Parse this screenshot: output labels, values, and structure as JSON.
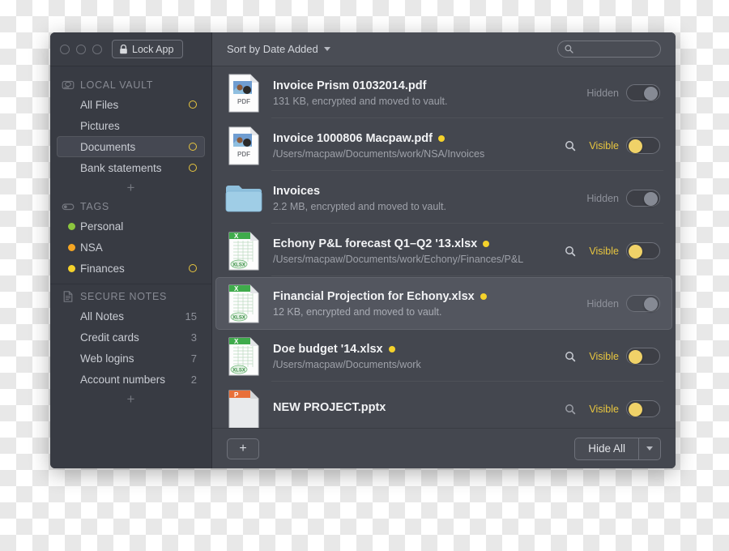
{
  "window": {
    "traffic_lights": [
      "close",
      "minimize",
      "zoom"
    ],
    "lock_button_label": "Lock App"
  },
  "sidebar": {
    "sections": [
      {
        "id": "local-vault",
        "title": "LOCAL VAULT",
        "icon": "hard-drive-icon",
        "items": [
          {
            "label": "All Files",
            "selected": false,
            "ring": true
          },
          {
            "label": "Pictures",
            "selected": false,
            "ring": false
          },
          {
            "label": "Documents",
            "selected": true,
            "ring": true
          },
          {
            "label": "Bank statements",
            "selected": false,
            "ring": true
          }
        ],
        "add_label": "+"
      },
      {
        "id": "tags",
        "title": "TAGS",
        "icon": "tag-toggle-icon",
        "items": [
          {
            "label": "Personal",
            "dot": "#8CC63E",
            "ring": false
          },
          {
            "label": "NSA",
            "dot": "#F5A623",
            "ring": false
          },
          {
            "label": "Finances",
            "dot": "#F5D22B",
            "ring": true
          }
        ]
      },
      {
        "id": "secure-notes",
        "title": "SECURE NOTES",
        "icon": "note-icon",
        "items": [
          {
            "label": "All Notes",
            "count": "15"
          },
          {
            "label": "Credit cards",
            "count": "3"
          },
          {
            "label": "Web logins",
            "count": "7"
          },
          {
            "label": "Account numbers",
            "count": "2"
          }
        ],
        "add_label": "+"
      }
    ]
  },
  "toolbar": {
    "sort_label": "Sort by Date Added",
    "sort_icon": "chevron-down-icon",
    "search_placeholder": "",
    "search_value": "",
    "search_icon": "search-icon"
  },
  "files": [
    {
      "title": "Invoice Prism 01032014.pdf",
      "subtitle": "131 KB, encrypted and moved to vault.",
      "icon": "pdf-file-icon",
      "tag_color": null,
      "state_label": "Hidden",
      "state": "hidden",
      "has_reveal": false,
      "selected": false
    },
    {
      "title": "Invoice 1000806 Macpaw.pdf",
      "subtitle": "/Users/macpaw/Documents/work/NSA/Invoices",
      "icon": "pdf-file-icon",
      "tag_color": "#F5D22B",
      "state_label": "Visible",
      "state": "visible",
      "has_reveal": true,
      "selected": false
    },
    {
      "title": "Invoices",
      "subtitle": "2.2 MB, encrypted and moved to vault.",
      "icon": "folder-icon",
      "tag_color": null,
      "state_label": "Hidden",
      "state": "hidden",
      "has_reveal": false,
      "selected": false
    },
    {
      "title": "Echony P&L forecast Q1–Q2 '13.xlsx",
      "subtitle": "/Users/macpaw/Documents/work/Echony/Finances/P&L",
      "icon": "xlsx-file-icon",
      "tag_color": "#F5D22B",
      "state_label": "Visible",
      "state": "visible",
      "has_reveal": true,
      "selected": false
    },
    {
      "title": "Financial Projection for Echony.xlsx",
      "subtitle": "12 KB, encrypted and moved to vault.",
      "icon": "xlsx-file-icon",
      "tag_color": "#F5D22B",
      "state_label": "Hidden",
      "state": "hidden",
      "has_reveal": false,
      "selected": true
    },
    {
      "title": "Doe budget '14.xlsx",
      "subtitle": "/Users/macpaw/Documents/work",
      "icon": "xlsx-file-icon",
      "tag_color": "#F5D22B",
      "state_label": "Visible",
      "state": "visible",
      "has_reveal": true,
      "selected": false
    },
    {
      "title": "NEW PROJECT.pptx",
      "subtitle": "",
      "icon": "pptx-file-icon",
      "tag_color": null,
      "state_label": "Visible",
      "state": "visible",
      "has_reveal": true,
      "selected": false
    }
  ],
  "bottom_bar": {
    "add_label": "+",
    "hide_all_label": "Hide All",
    "hide_all_arrow_icon": "chevron-down-icon"
  },
  "colors": {
    "accent_yellow": "#E8C63F",
    "window_bg": "#3D4049",
    "sidebar_bg": "#383B43",
    "list_bg": "#44474F",
    "selected_row": "#53565F"
  }
}
